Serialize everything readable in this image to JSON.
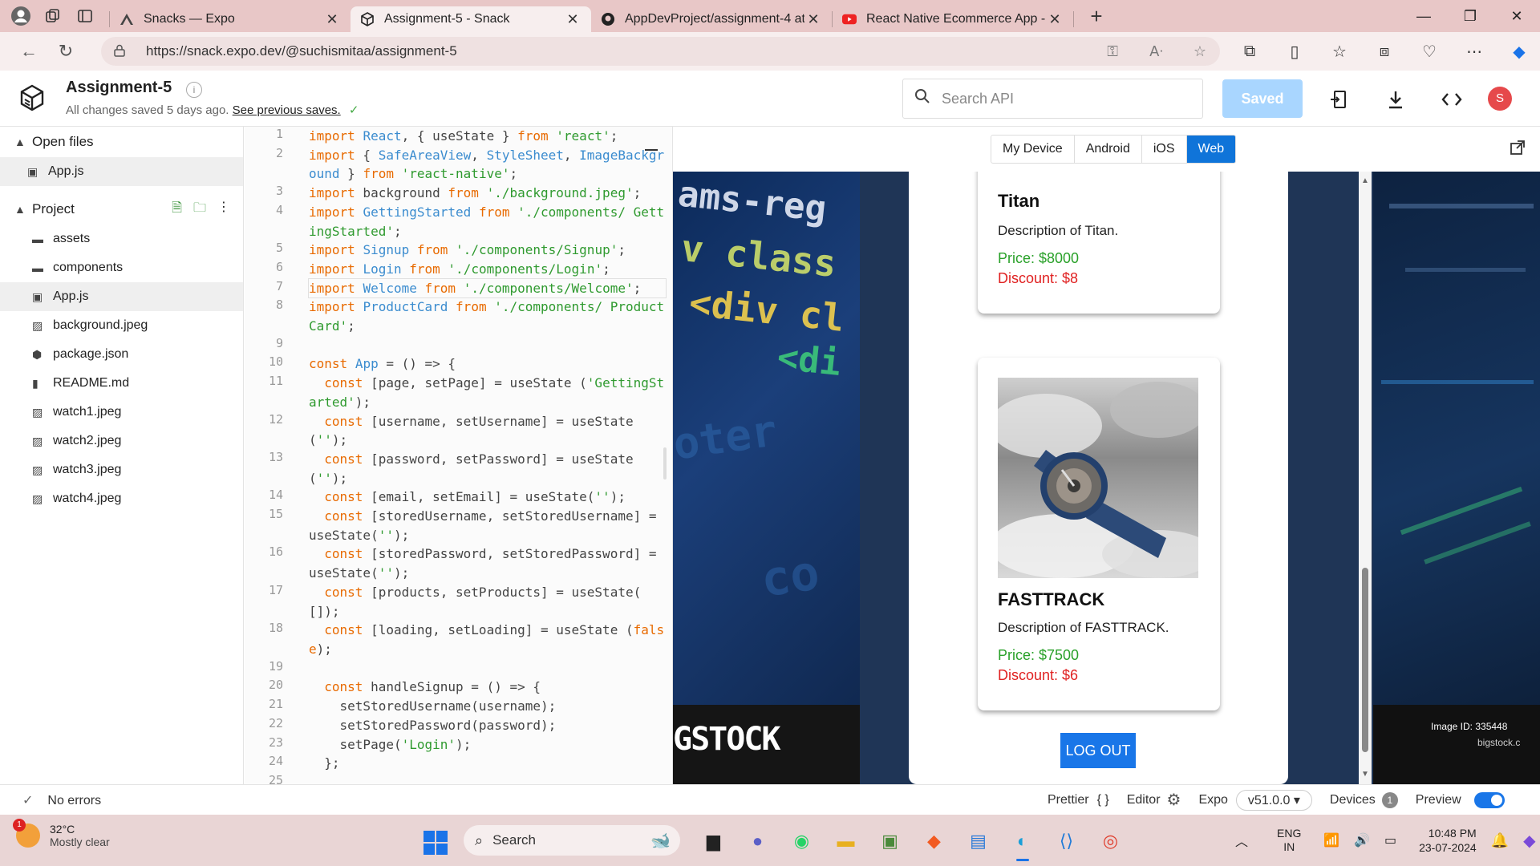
{
  "browser": {
    "tabs": [
      {
        "label": "Snacks — Expo",
        "icon": "expo-icon",
        "active": false
      },
      {
        "label": "Assignment-5 - Snack",
        "icon": "snack-icon",
        "active": true
      },
      {
        "label": "AppDevProject/assignment-4 at",
        "icon": "github-icon",
        "active": false
      },
      {
        "label": "React Native Ecommerce App - R",
        "icon": "youtube-icon",
        "active": false
      }
    ],
    "url": "https://snack.expo.dev/@suchismitaa/assignment-5"
  },
  "header": {
    "title": "Assignment-5",
    "status_text": "All changes saved 5 days ago.",
    "previous_link": "See previous saves.",
    "search_placeholder": "Search API",
    "saved_label": "Saved",
    "avatar_letter": "S"
  },
  "sidebar": {
    "open_files_label": "Open files",
    "open_files": [
      {
        "name": "App.js",
        "icon": "js-file-icon"
      }
    ],
    "project_label": "Project",
    "files": [
      {
        "name": "assets",
        "icon": "folder-icon",
        "active": false
      },
      {
        "name": "components",
        "icon": "folder-icon",
        "active": false
      },
      {
        "name": "App.js",
        "icon": "js-file-icon",
        "active": true
      },
      {
        "name": "background.jpeg",
        "icon": "image-file-icon",
        "active": false
      },
      {
        "name": "package.json",
        "icon": "package-icon",
        "active": false
      },
      {
        "name": "README.md",
        "icon": "doc-file-icon",
        "active": false
      },
      {
        "name": "watch1.jpeg",
        "icon": "image-file-icon",
        "active": false
      },
      {
        "name": "watch2.jpeg",
        "icon": "image-file-icon",
        "active": false
      },
      {
        "name": "watch3.jpeg",
        "icon": "image-file-icon",
        "active": false
      },
      {
        "name": "watch4.jpeg",
        "icon": "image-file-icon",
        "active": false
      }
    ]
  },
  "editor": {
    "lines": [
      {
        "n": "1",
        "html": "<span class=\"kw\">import</span> <span class=\"ty\">React</span>, { useState } <span class=\"kw\">from</span> <span class=\"st\">'react'</span>;"
      },
      {
        "n": "2",
        "html": "<span class=\"kw\">import</span> { <span class=\"ty\">SafeAreaView</span>, <span class=\"ty\">StyleSheet</span>, <span class=\"ty\">ImageBackground</span> } <span class=\"kw\">from</span> <span class=\"st\">'react-native'</span>;"
      },
      {
        "n": "3",
        "html": "<span class=\"kw\">import</span> background <span class=\"kw\">from</span> <span class=\"st\">'./background.jpeg'</span>;"
      },
      {
        "n": "4",
        "html": "<span class=\"kw\">import</span> <span class=\"ty\">GettingStarted</span> <span class=\"kw\">from</span> <span class=\"st\">'./components/ GettingStarted'</span>;"
      },
      {
        "n": "5",
        "html": "<span class=\"kw\">import</span> <span class=\"ty\">Signup</span> <span class=\"kw\">from</span> <span class=\"st\">'./components/Signup'</span>;"
      },
      {
        "n": "6",
        "html": "<span class=\"kw\">import</span> <span class=\"ty\">Login</span> <span class=\"kw\">from</span> <span class=\"st\">'./components/Login'</span>;"
      },
      {
        "n": "7",
        "html": "<span class=\"kw\">import</span> <span class=\"ty\">Welcome</span> <span class=\"kw\">from</span> <span class=\"st\">'./components/Welcome'</span>;",
        "hl": true
      },
      {
        "n": "8",
        "html": "<span class=\"kw\">import</span> <span class=\"ty\">ProductCard</span> <span class=\"kw\">from</span> <span class=\"st\">'./components/ ProductCard'</span>;"
      },
      {
        "n": "9",
        "html": " "
      },
      {
        "n": "10",
        "html": "<span class=\"kw\">const</span> <span class=\"ty\">App</span> = () => {"
      },
      {
        "n": "11",
        "html": "  <span class=\"kw\">const</span> [page, setPage] = useState (<span class=\"st\">'GettingStarted'</span>);"
      },
      {
        "n": "12",
        "html": "  <span class=\"kw\">const</span> [username, setUsername] = useState (<span class=\"st\">''</span>);"
      },
      {
        "n": "13",
        "html": "  <span class=\"kw\">const</span> [password, setPassword] = useState (<span class=\"st\">''</span>);"
      },
      {
        "n": "14",
        "html": "  <span class=\"kw\">const</span> [email, setEmail] = useState(<span class=\"st\">''</span>);"
      },
      {
        "n": "15",
        "html": "  <span class=\"kw\">const</span> [storedUsername, setStoredUsername] = useState(<span class=\"st\">''</span>);"
      },
      {
        "n": "16",
        "html": "  <span class=\"kw\">const</span> [storedPassword, setStoredPassword] = useState(<span class=\"st\">''</span>);"
      },
      {
        "n": "17",
        "html": "  <span class=\"kw\">const</span> [products, setProducts] = useState( []);"
      },
      {
        "n": "18",
        "html": "  <span class=\"kw\">const</span> [loading, setLoading] = useState (<span class=\"kw\">false</span>);"
      },
      {
        "n": "19",
        "html": " "
      },
      {
        "n": "20",
        "html": "  <span class=\"kw\">const</span> handleSignup = () => {"
      },
      {
        "n": "21",
        "html": "    setStoredUsername(username);"
      },
      {
        "n": "22",
        "html": "    setStoredPassword(password);"
      },
      {
        "n": "23",
        "html": "    setPage(<span class=\"st\">'Login'</span>);"
      },
      {
        "n": "24",
        "html": "  };"
      },
      {
        "n": "25",
        "html": " "
      }
    ]
  },
  "preview": {
    "tabs": [
      {
        "label": "My Device",
        "active": false
      },
      {
        "label": "Android",
        "active": false
      },
      {
        "label": "iOS",
        "active": false
      },
      {
        "label": "Web",
        "active": true
      }
    ],
    "bg_text": [
      "ams-reg",
      "v class",
      "<div cl",
      "<di",
      "oter",
      "co"
    ],
    "bigstock_label": "GSTOCK",
    "right_bg": {
      "image_id": "Image ID: 335448",
      "site": "bigstock.c"
    },
    "products": [
      {
        "name": "Titan",
        "description": "Description of Titan.",
        "price": "Price: $8000",
        "discount": "Discount: $8"
      },
      {
        "name": "FASTTRACK",
        "description": "Description of FASTTRACK.",
        "price": "Price: $7500",
        "discount": "Discount: $6"
      }
    ],
    "logout_label": "LOG OUT"
  },
  "statusbar": {
    "errors": "No errors",
    "prettier": "Prettier",
    "editor": "Editor",
    "expo": "Expo",
    "version": "v51.0.0 ▾",
    "devices": "Devices",
    "devices_count": "1",
    "preview": "Preview"
  },
  "taskbar": {
    "temperature": "32°C",
    "weather": "Mostly clear",
    "weather_badge": "1",
    "search": "Search",
    "lang1": "ENG",
    "lang2": "IN",
    "time": "10:48 PM",
    "date": "23-07-2024"
  },
  "colors": {
    "accent": "#0f74d9",
    "saved_button": "#a9d6ff",
    "price": "#2aa12a",
    "discount": "#e02222",
    "logout": "#1976e8"
  }
}
